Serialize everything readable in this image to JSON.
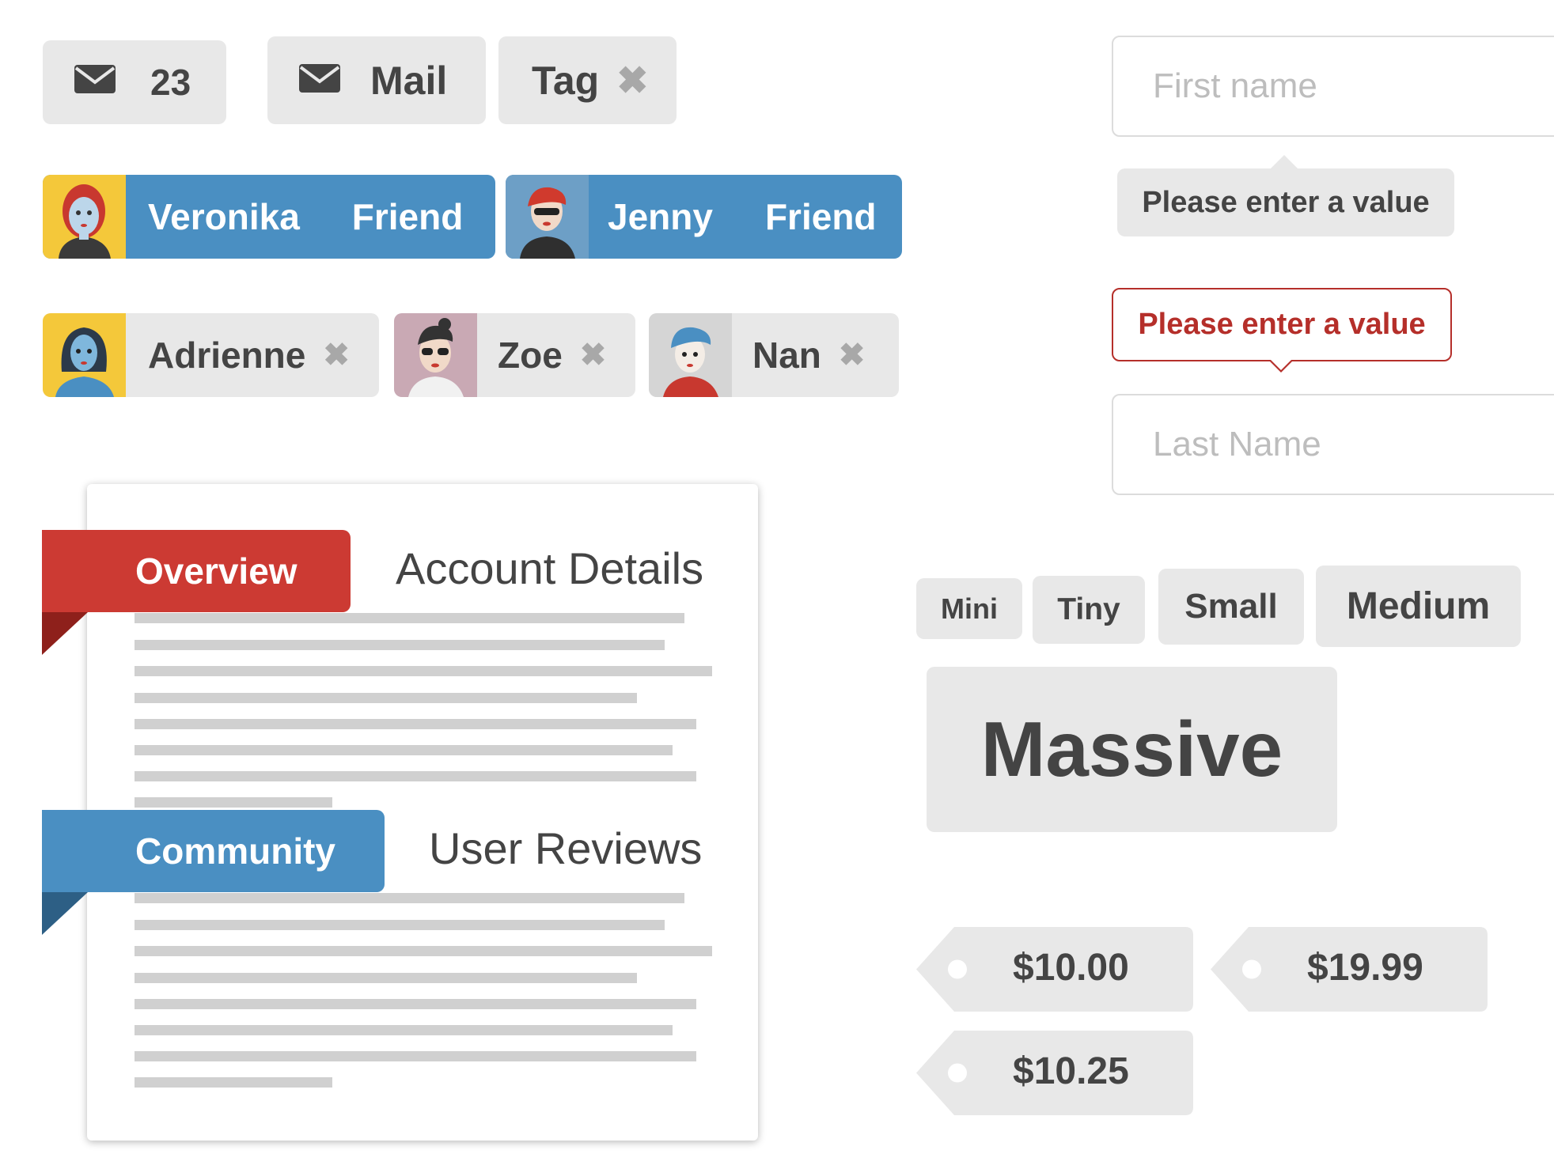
{
  "top_labels": {
    "mail_count": "23",
    "mail_text": "Mail",
    "tag_text": "Tag"
  },
  "friends": [
    {
      "name": "Veronika",
      "detail": "Friend"
    },
    {
      "name": "Jenny",
      "detail": "Friend"
    }
  ],
  "people": [
    {
      "name": "Adrienne"
    },
    {
      "name": "Zoe"
    },
    {
      "name": "Nan"
    }
  ],
  "form": {
    "first_name_placeholder": "First name",
    "pointing_below": "Please enter a value",
    "pointing_above_error": "Please enter a value",
    "last_name_placeholder": "Last Name"
  },
  "card": {
    "section1": {
      "ribbon": "Overview",
      "title": "Account Details"
    },
    "section2": {
      "ribbon": "Community",
      "title": "User Reviews"
    }
  },
  "sizes": [
    "Mini",
    "Tiny",
    "Small",
    "Medium",
    "Massive"
  ],
  "prices": [
    "$10.00",
    "$19.99",
    "$10.25"
  ],
  "colors": {
    "blue": "#4a8fc2",
    "red": "#cc3a33",
    "label_gray": "#e8e8e8",
    "error_red": "#b52f2a"
  },
  "icons": [
    "mail-icon",
    "delete-icon"
  ]
}
